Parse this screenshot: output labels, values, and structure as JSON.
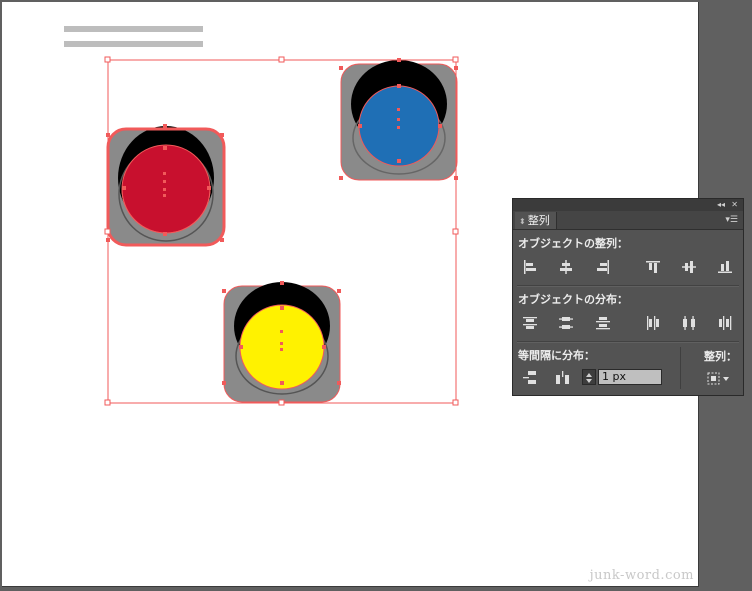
{
  "watermark": "junk-word.com",
  "colors": {
    "selection": "#f15a5a",
    "red_light": "#c8102e",
    "blue_light": "#1f6fb5",
    "yellow_light": "#fff200",
    "housing": "#8a8a8a",
    "panel_bg": "#535353"
  },
  "panel": {
    "collapse_icon": "double-chevron-icon",
    "close_icon": "close-icon",
    "tab_label": "整列",
    "menu_icon": "panel-menu-icon",
    "align_objects_title": "オブジェクトの整列：",
    "distribute_objects_title": "オブジェクトの分布：",
    "distribute_spacing_title": "等間隔に分布：",
    "align_to_label": "整列：",
    "spacing_value": "1 px",
    "align_buttons": [
      "horizontal-align-left-icon",
      "horizontal-align-center-icon",
      "horizontal-align-right-icon",
      "vertical-align-top-icon",
      "vertical-align-center-icon",
      "vertical-align-bottom-icon"
    ],
    "distribute_buttons": [
      "vertical-distribute-top-icon",
      "vertical-distribute-center-icon",
      "vertical-distribute-bottom-icon",
      "horizontal-distribute-left-icon",
      "horizontal-distribute-center-icon",
      "horizontal-distribute-right-icon"
    ],
    "spacing_buttons": [
      "vertical-distribute-space-icon",
      "horizontal-distribute-space-icon"
    ],
    "align_to_icon": "align-to-selection-icon"
  }
}
